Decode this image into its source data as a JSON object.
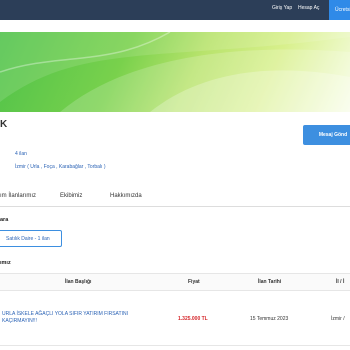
{
  "topbar": {
    "login": "Giriş Yap",
    "register": "Hesap Aç",
    "cta": "Ücretsiz"
  },
  "profile": {
    "name_initial": "K",
    "listing_count": "4 ilan",
    "locations": "İzmir ( Urla , Foça , Karabağlar , Torbalı )",
    "message_button": "Mesaj Gönd"
  },
  "tabs": [
    "ım İlanlarımız",
    "Ekibimiz",
    "Hakkımızda"
  ],
  "filter": {
    "label": "ara",
    "chip": "Satılık Daire - 1 ilan"
  },
  "listings": {
    "label": "ımız",
    "columns": [
      "İlan Başlığı",
      "Fiyat",
      "İlan Tarihi",
      "İl / İ"
    ],
    "rows": [
      {
        "title": "URLA İSKELE AĞAÇLI YOLA SIFIR YATIRIM FIRSATINI KAÇIRMAYIN!!!",
        "price": "1.325.000 TL",
        "date": "15 Temmuz 2023",
        "location": "İzmir /"
      }
    ]
  },
  "colors": {
    "topbar": "#2c3e58",
    "accent": "#3d8fe0",
    "price": "#d5262a",
    "banner_green": "#79d14c"
  }
}
